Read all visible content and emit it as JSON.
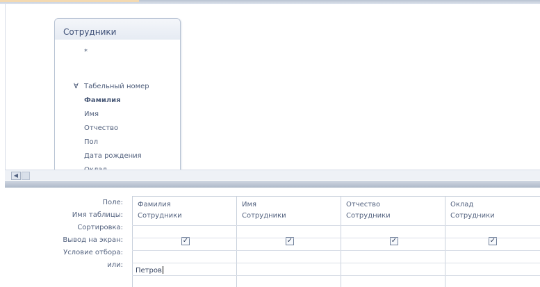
{
  "table": {
    "title": "Сотрудники",
    "fields": [
      "*",
      "Табельный номер",
      "Фамилия",
      "Имя",
      "Отчество",
      "Пол",
      "Дата рождения",
      "Оклад"
    ],
    "key_marker": "∀"
  },
  "grid": {
    "row_labels": [
      "Поле:",
      "Имя таблицы:",
      "Сортировка:",
      "Вывод на экран:",
      "Условие отбора:",
      "или:"
    ],
    "columns": [
      {
        "field": "Фамилия",
        "table": "Сотрудники",
        "show": true,
        "criteria": "Петров"
      },
      {
        "field": "Имя",
        "table": "Сотрудники",
        "show": true,
        "criteria": ""
      },
      {
        "field": "Отчество",
        "table": "Сотрудники",
        "show": true,
        "criteria": ""
      },
      {
        "field": "Оклад",
        "table": "Сотрудники",
        "show": true,
        "criteria": ""
      }
    ]
  }
}
